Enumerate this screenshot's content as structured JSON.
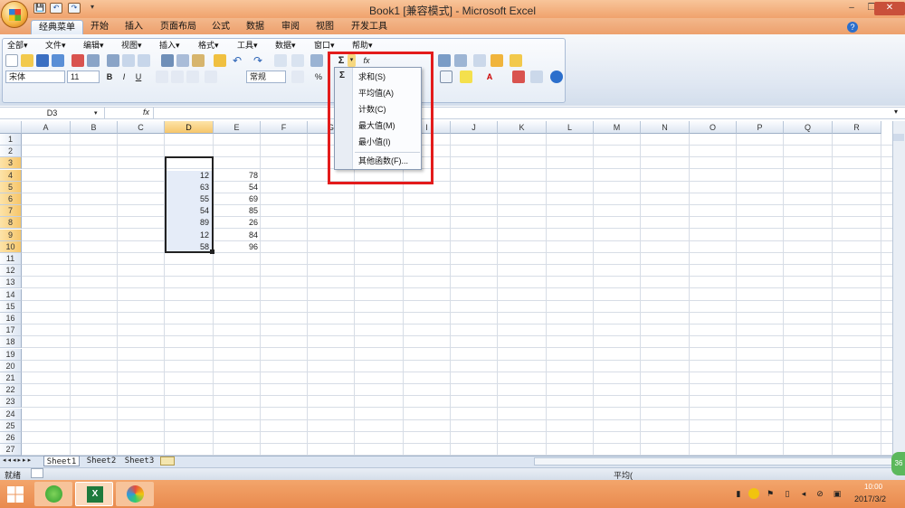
{
  "window": {
    "title": "Book1  [兼容模式] - Microsoft Excel",
    "min": "–",
    "restore": "❐",
    "close": "✕"
  },
  "qat": {
    "save": "💾",
    "undo": "↶",
    "redo": "↷",
    "more": "▾"
  },
  "tabs": [
    "经典菜单",
    "开始",
    "插入",
    "页面布局",
    "公式",
    "数据",
    "审阅",
    "视图",
    "开发工具"
  ],
  "help": "?",
  "menus": [
    "全部▾",
    "文件▾",
    "编辑▾",
    "视图▾",
    "插入▾",
    "格式▾",
    "工具▾",
    "数据▾",
    "窗口▾",
    "帮助▾"
  ],
  "format": {
    "font": "宋体",
    "size": "11",
    "bold": "B",
    "italic": "I",
    "underline": "U",
    "number_format": "常规",
    "percent": "%"
  },
  "namebox": "D3",
  "fx": "fx",
  "columns": [
    "A",
    "B",
    "C",
    "D",
    "E",
    "F",
    "G",
    "H",
    "I",
    "J",
    "K",
    "L",
    "M",
    "N",
    "O",
    "P",
    "Q",
    "R"
  ],
  "rows": [
    "1",
    "2",
    "3",
    "4",
    "5",
    "6",
    "7",
    "8",
    "9",
    "10",
    "11",
    "12",
    "13",
    "14",
    "15",
    "16",
    "17",
    "18",
    "19",
    "20",
    "21",
    "22",
    "23",
    "24",
    "25",
    "26",
    "27"
  ],
  "data_d": [
    "12",
    "63",
    "55",
    "54",
    "89",
    "12",
    "58"
  ],
  "data_e": [
    "78",
    "54",
    "69",
    "85",
    "26",
    "84",
    "96"
  ],
  "sheets": [
    "Sheet1",
    "Sheet2",
    "Sheet3"
  ],
  "status": {
    "ready": "就绪",
    "avg": "平均("
  },
  "dropdown": {
    "sigma": "Σ",
    "items": [
      "求和(S)",
      "平均值(A)",
      "计数(C)",
      "最大值(M)",
      "最小值(I)"
    ],
    "more": "其他函数(F)..."
  },
  "tray": {
    "time": "10:00",
    "date": "2017/3/2",
    "badge": "36"
  }
}
